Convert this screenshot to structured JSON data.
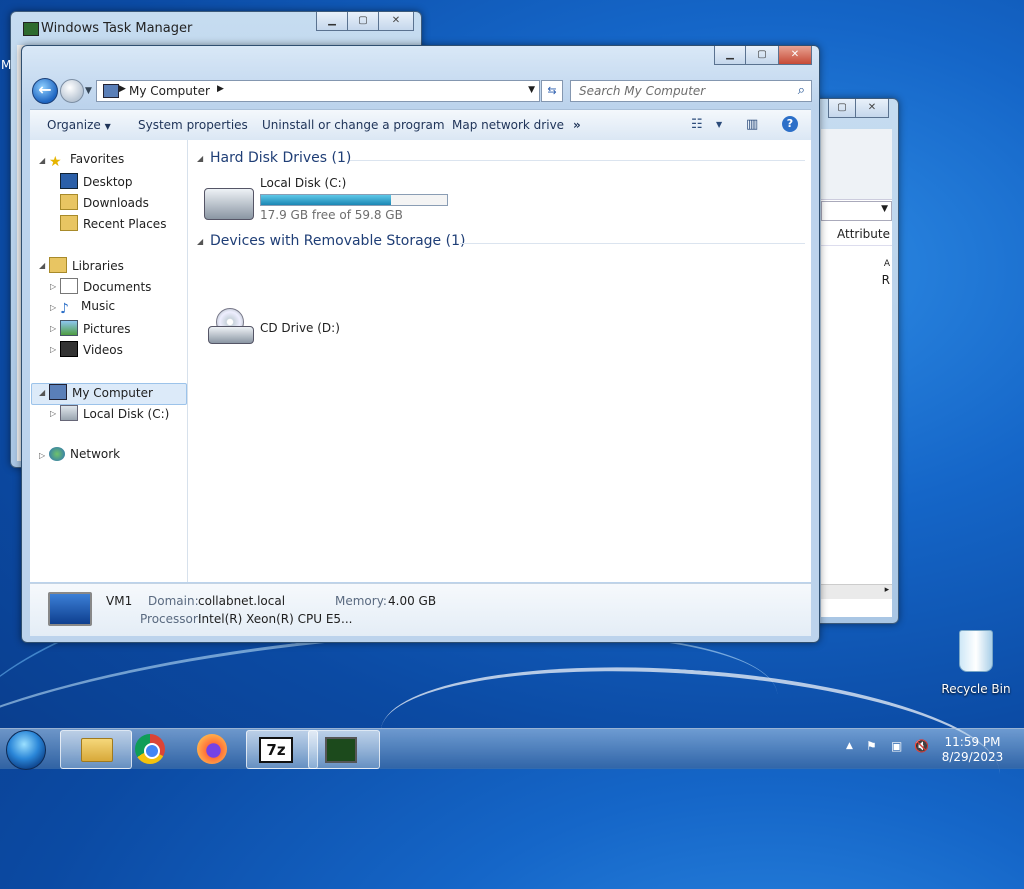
{
  "taskmgr": {
    "title": "Windows Task Manager",
    "left_edge_char": "M"
  },
  "bgwin": {
    "attributes_header": "Attribute",
    "cell_a": "A",
    "cell_r": "R"
  },
  "explorer": {
    "address": "My Computer",
    "search_placeholder": "Search My Computer",
    "toolbar": {
      "organize": "Organize",
      "system_properties": "System properties",
      "uninstall": "Uninstall or change a program",
      "map_drive": "Map network drive",
      "more": "»"
    },
    "nav": {
      "favorites": "Favorites",
      "desktop": "Desktop",
      "downloads": "Downloads",
      "recent_places": "Recent Places",
      "libraries": "Libraries",
      "documents": "Documents",
      "music": "Music",
      "pictures": "Pictures",
      "videos": "Videos",
      "my_computer": "My Computer",
      "local_disk": "Local Disk (C:)",
      "network": "Network"
    },
    "content": {
      "hdd_group": "Hard Disk Drives (1)",
      "local_disk": {
        "name": "Local Disk (C:)",
        "free": "17.9 GB free of 59.8 GB",
        "used_fraction": 0.7
      },
      "removable_group": "Devices with Removable Storage (1)",
      "cd_drive": {
        "name": "CD Drive (D:)"
      }
    },
    "details": {
      "computer_name": "VM1",
      "domain_label": "Domain:",
      "domain_value": "collabnet.local",
      "memory_label": "Memory:",
      "memory_value": "4.00 GB",
      "processor_label": "Processor:",
      "processor_value": "Intel(R) Xeon(R) CPU E5..."
    }
  },
  "desktop": {
    "recycle_bin": "Recycle Bin"
  },
  "taskbar": {
    "time": "11:59 PM",
    "date": "8/29/2023",
    "seven_zip": "7z"
  }
}
